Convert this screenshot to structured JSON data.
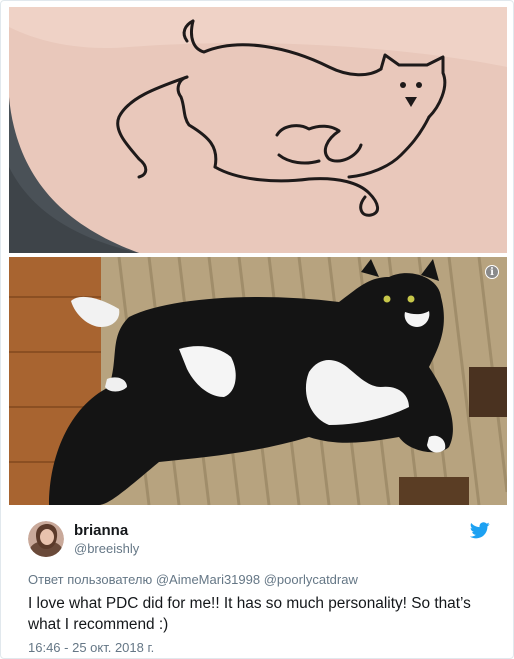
{
  "media": {
    "info_icon": "i",
    "images": [
      {
        "icon": "cat-tattoo-drawing",
        "description_name": "tattoo-photo"
      },
      {
        "icon": "tuxedo-cat-photo",
        "description_name": "cat-photo"
      }
    ]
  },
  "user": {
    "display_name": "brianna",
    "handle": "@breeishly",
    "avatar_icon": "user-avatar"
  },
  "brand": {
    "icon": "twitter-bird-icon",
    "color": "#1da1f2"
  },
  "reply": {
    "prefix": "Ответ пользователю",
    "mention_1": "@AimeMari31998",
    "mention_2": "@poorlycatdraw"
  },
  "tweet": {
    "text": "I love what PDC did for me!! It has so much personality! So that’s what I recommend :)"
  },
  "timestamp": "16:46 - 25 окт. 2018 г.",
  "colors": {
    "text": "#14171a",
    "muted": "#657786",
    "border": "#e1e8ed"
  }
}
